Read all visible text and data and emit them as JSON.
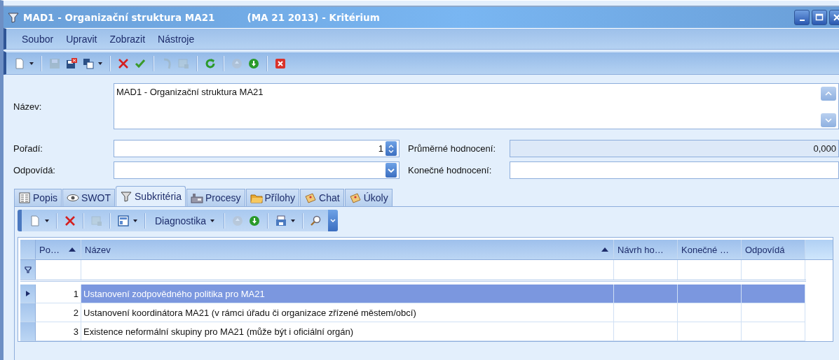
{
  "window": {
    "title": "MAD1 - Organizační struktura MA21",
    "subtitle": "(MA 21 2013) - Kritérium"
  },
  "menu": [
    "Soubor",
    "Upravit",
    "Zobrazit",
    "Nástroje"
  ],
  "toolbar": [
    {
      "kind": "new",
      "disabled": false,
      "dropdown": true
    },
    {
      "kind": "separator"
    },
    {
      "kind": "save",
      "disabled": true,
      "dropdown": false
    },
    {
      "kind": "save-close",
      "disabled": false,
      "dropdown": false
    },
    {
      "kind": "copy",
      "disabled": false,
      "dropdown": true
    },
    {
      "kind": "separator"
    },
    {
      "kind": "delete",
      "disabled": false,
      "dropdown": false
    },
    {
      "kind": "confirm",
      "disabled": false,
      "dropdown": false
    },
    {
      "kind": "separator"
    },
    {
      "kind": "undo",
      "disabled": true,
      "dropdown": false
    },
    {
      "kind": "grid",
      "disabled": true,
      "dropdown": false
    },
    {
      "kind": "separator"
    },
    {
      "kind": "refresh",
      "disabled": false,
      "dropdown": false
    },
    {
      "kind": "separator"
    },
    {
      "kind": "up",
      "disabled": true,
      "dropdown": false
    },
    {
      "kind": "down",
      "disabled": false,
      "dropdown": false
    },
    {
      "kind": "separator"
    },
    {
      "kind": "close",
      "disabled": false,
      "dropdown": false
    }
  ],
  "form": {
    "name": {
      "label": "Název:",
      "value": "MAD1 - Organizační struktura MA21"
    },
    "order": {
      "label": "Pořadí:",
      "value": "1"
    },
    "responsible": {
      "label": "Odpovídá:"
    },
    "average": {
      "label": "Průměrné hodnocení:",
      "value": "0,000",
      "readonly": true
    },
    "final": {
      "label": "Konečné hodnocení:",
      "readonly": false
    }
  },
  "tabs": [
    {
      "label": "Popis",
      "kind": "list",
      "selected": false
    },
    {
      "label": "SWOT",
      "kind": "eye",
      "selected": false
    },
    {
      "label": "Subkritéria",
      "kind": "funnel",
      "selected": true
    },
    {
      "label": "Procesy",
      "kind": "machine",
      "selected": false
    },
    {
      "label": "Přílohy",
      "kind": "folder",
      "selected": false
    },
    {
      "label": "Chat",
      "kind": "note",
      "selected": false
    },
    {
      "label": "Úkoly",
      "kind": "note",
      "selected": false
    }
  ],
  "subtoolbar": [
    {
      "kind": "new",
      "disabled": false,
      "dropdown": true
    },
    {
      "kind": "separator"
    },
    {
      "kind": "delete",
      "disabled": false,
      "dropdown": false
    },
    {
      "kind": "separator"
    },
    {
      "kind": "grid",
      "disabled": true,
      "dropdown": false
    },
    {
      "kind": "separator"
    },
    {
      "kind": "layout",
      "disabled": false,
      "dropdown": true
    },
    {
      "kind": "separator"
    },
    {
      "kind": "text",
      "label": "Diagnostika",
      "disabled": false,
      "dropdown": true
    },
    {
      "kind": "separator"
    },
    {
      "kind": "up",
      "disabled": true,
      "dropdown": false
    },
    {
      "kind": "down",
      "disabled": false,
      "dropdown": false
    },
    {
      "kind": "separator"
    },
    {
      "kind": "print",
      "disabled": false,
      "dropdown": true
    },
    {
      "kind": "separator"
    },
    {
      "kind": "search",
      "disabled": false,
      "dropdown": false
    }
  ],
  "table": {
    "columns": [
      {
        "label": "Po…",
        "sorted": true
      },
      {
        "label": "Název",
        "sorted": true
      },
      {
        "label": "Návrh ho…",
        "sorted": false
      },
      {
        "label": "Konečné …",
        "sorted": false
      },
      {
        "label": "Odpovídá",
        "sorted": false
      }
    ],
    "rows": [
      {
        "selected": true,
        "cells": [
          "1",
          "Ustanovení zodpovědného politika pro MA21"
        ]
      },
      {
        "selected": false,
        "cells": [
          "2",
          "Ustanovení koordinátora MA21 (v rámci úřadu či organizace zřízené městem/obcí)"
        ]
      },
      {
        "selected": false,
        "cells": [
          "3",
          "Existence neformální skupiny pro MA21 (může být i oficiální orgán)"
        ]
      }
    ]
  }
}
